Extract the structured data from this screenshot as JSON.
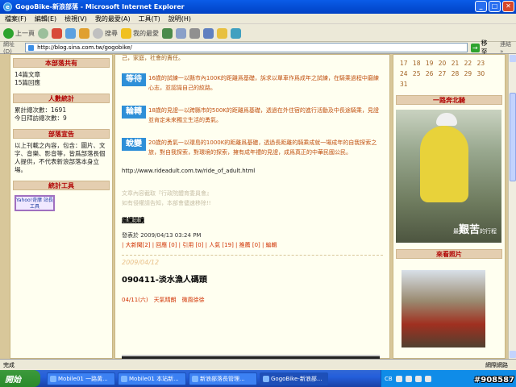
{
  "window": {
    "title": "GogoBike-新浪部落 - Microsoft Internet Explorer",
    "minimize": "_",
    "maximize": "□",
    "close": "✕",
    "icon_letter": "e"
  },
  "menu": [
    "檔案(F)",
    "編輯(E)",
    "檢視(V)",
    "我的最愛(A)",
    "工具(T)",
    "說明(H)"
  ],
  "toolbar": {
    "back": "上一頁",
    "search": "搜尋",
    "favorites": "我的最愛"
  },
  "address": {
    "label": "網址(D)",
    "url": "http://blog.sina.com.tw/gogobike/",
    "go": "移至",
    "go_arrow": "→",
    "links": "連結 »"
  },
  "left": {
    "sections": [
      {
        "title": "本部落共有",
        "lines": [
          "14篇文章",
          "15篇回應"
        ]
      },
      {
        "title": "人數統計",
        "lines": [
          "累計總次數：1691",
          "今日拜訪總次數：9"
        ]
      },
      {
        "title": "部落宣告",
        "lines": [
          "以上刊載之內容，包含：圖片、文",
          "字、音樂、影音等，皆爲部落長個",
          "人提供，不代表新浪部落本身立",
          "場。"
        ]
      },
      {
        "title": "統計工具",
        "lines": []
      }
    ],
    "badge": "Yahoo!奇摩 站長工具"
  },
  "center": {
    "top_text": "己，家庭，社會的責任。",
    "paragraphs": [
      {
        "tag": "等待",
        "text": "16歲的試練一以縣市內100K的距離爲基礎，訴求以單車作爲成年之試練，在騎乘過程中磨練心志，並認識自己的紋路。"
      },
      {
        "tag": "輪轉",
        "text": "18歲的見證一以跨縣市的500K的距離爲基礎，透過在外住宿的進行活動及中長途騎乘，見證並肯定未來獨立生活的勇氣。"
      },
      {
        "tag": "蛻變",
        "text": "20歲的勇氣一以環島的1000K的距離爲基礎，透過長距離的騎乘成就一場成年的自我探索之旅，對自我探索，對環境的探索，擁有成年禮的見證，成爲真正的中華民國公民。"
      }
    ],
    "url": "http://www.rideadult.com.tw/ride_of_adult.html",
    "source": [
      "文章內容截取『行政院體育委員會』",
      "如有侵權請告知，本部會儘速移除!!"
    ],
    "more": "繼續閱讀",
    "posted": "發表於 2009/04/13 03:24 PM",
    "actions": "| 大新聞[2] | 回應 [0] | 引用 [0] | 人氣 [19] | 推薦 [0] | 編輯",
    "date": "2009/04/12",
    "post_title": "090411-淡水漁人碼頭",
    "post_line": "04/11(六)　天氣晴朗　微風徐徐"
  },
  "right": {
    "calendar_rows": [
      "17 18 19 20 21 22 23",
      "24 25 26 27 28 29 30",
      "31"
    ],
    "sections": [
      {
        "title": "一路奔北騎"
      },
      {
        "title": "來看照片"
      }
    ],
    "photo_caption_big": "艱苦",
    "photo_caption_pre": "最",
    "photo_caption_post": "的行程"
  },
  "status": {
    "left": "完成",
    "zone": "網際網路"
  },
  "taskbar": {
    "start": "開始",
    "tasks": [
      "Mobile01 一路黃...",
      "Mobile01 本站新...",
      "新浪部落長管理...",
      "GogoBike-新浪部..."
    ],
    "tray_lang": "CB",
    "watermark": "#908587"
  }
}
